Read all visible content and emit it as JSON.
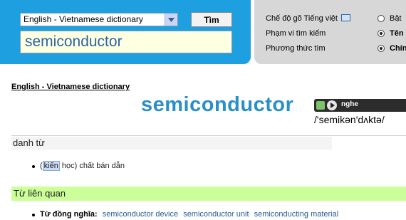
{
  "search": {
    "dictionary_selected": "English - Vietnamese dictionary",
    "query": "semiconductor",
    "button_label": "Tìm"
  },
  "options": {
    "typing_mode_label": "Chế độ gõ Tiếng việt",
    "scope_label": "Phạm vi tìm kiếm",
    "method_label": "Phương thức tìm",
    "radio_typing": "Bật",
    "radio_scope": "Tên",
    "radio_method": "Chính"
  },
  "entry": {
    "dictionary_link": "English - Vietnamese dictionary",
    "headword": "semiconductor",
    "audio_label": "nghe",
    "pronunciation": "/'semikən'dʌktə/"
  },
  "definition": {
    "part_of_speech": "danh từ",
    "meaning_open": "(",
    "meaning_highlight": "kiến",
    "meaning_rest": " học) chất bán dẫn"
  },
  "related": {
    "header": "Từ liên quan",
    "synonyms_label": "Từ đồng nghĩa:",
    "synonyms": [
      "semiconductor device",
      "semiconductor unit",
      "semiconducting material"
    ]
  },
  "colors": {
    "accent_blue": "#1ea0e0",
    "headword_blue": "#2a8fc8",
    "related_header_bg": "#ccff99",
    "link_blue": "#2a5b95"
  }
}
